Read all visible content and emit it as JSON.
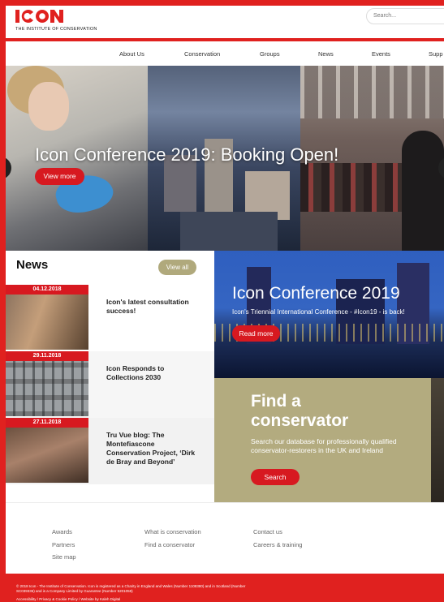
{
  "header": {
    "logo_word": "Icon",
    "logo_sub": "THE INSTITUTE OF CONSERVATION",
    "search_placeholder": "Search..."
  },
  "nav": [
    "About Us",
    "Conservation",
    "Groups",
    "News",
    "Events",
    "Supp"
  ],
  "hero": {
    "title": "Icon Conference 2019: Booking Open!",
    "button": "View more"
  },
  "news": {
    "heading": "News",
    "view_all": "View all",
    "items": [
      {
        "date": "04.12.2018",
        "title": "Icon's latest consultation success!"
      },
      {
        "date": "29.11.2018",
        "title": "Icon Responds to Collections 2030"
      },
      {
        "date": "27.11.2018",
        "title": "Tru Vue blog: The Montefiascone Conservation Project, ‘Dirk de Bray and Beyond’"
      }
    ]
  },
  "conference": {
    "title": "Icon Conference 2019",
    "subtitle": "Icon's Triennial International Conference - #Icon19 - is back!",
    "button": "Read more"
  },
  "find": {
    "title": "Find a conservator",
    "description": "Search our database for professionally qualified conservator-restorers in the UK and Ireland",
    "button": "Search"
  },
  "footer": {
    "col1": [
      "Awards",
      "Partners",
      "Site map"
    ],
    "col2": [
      "What is conservation",
      "Find a conservator"
    ],
    "col3": [
      "Contact us",
      "Careers & training"
    ]
  },
  "legal": {
    "text": "© 2018 Icon - The Institute of Conservation. Icon is registered as a Charity in England and Wales (Number 1108380) and in Scotland (Number SC039336) and is a Company Limited by Guarantee (Number 5201058)",
    "links": "Accessibility  /  Privacy & Cookie Policy  /  Website by Kaleh Digital"
  },
  "colors": {
    "accent": "#e0211f",
    "olive": "#b3ab7f",
    "button_red": "#d71920"
  }
}
